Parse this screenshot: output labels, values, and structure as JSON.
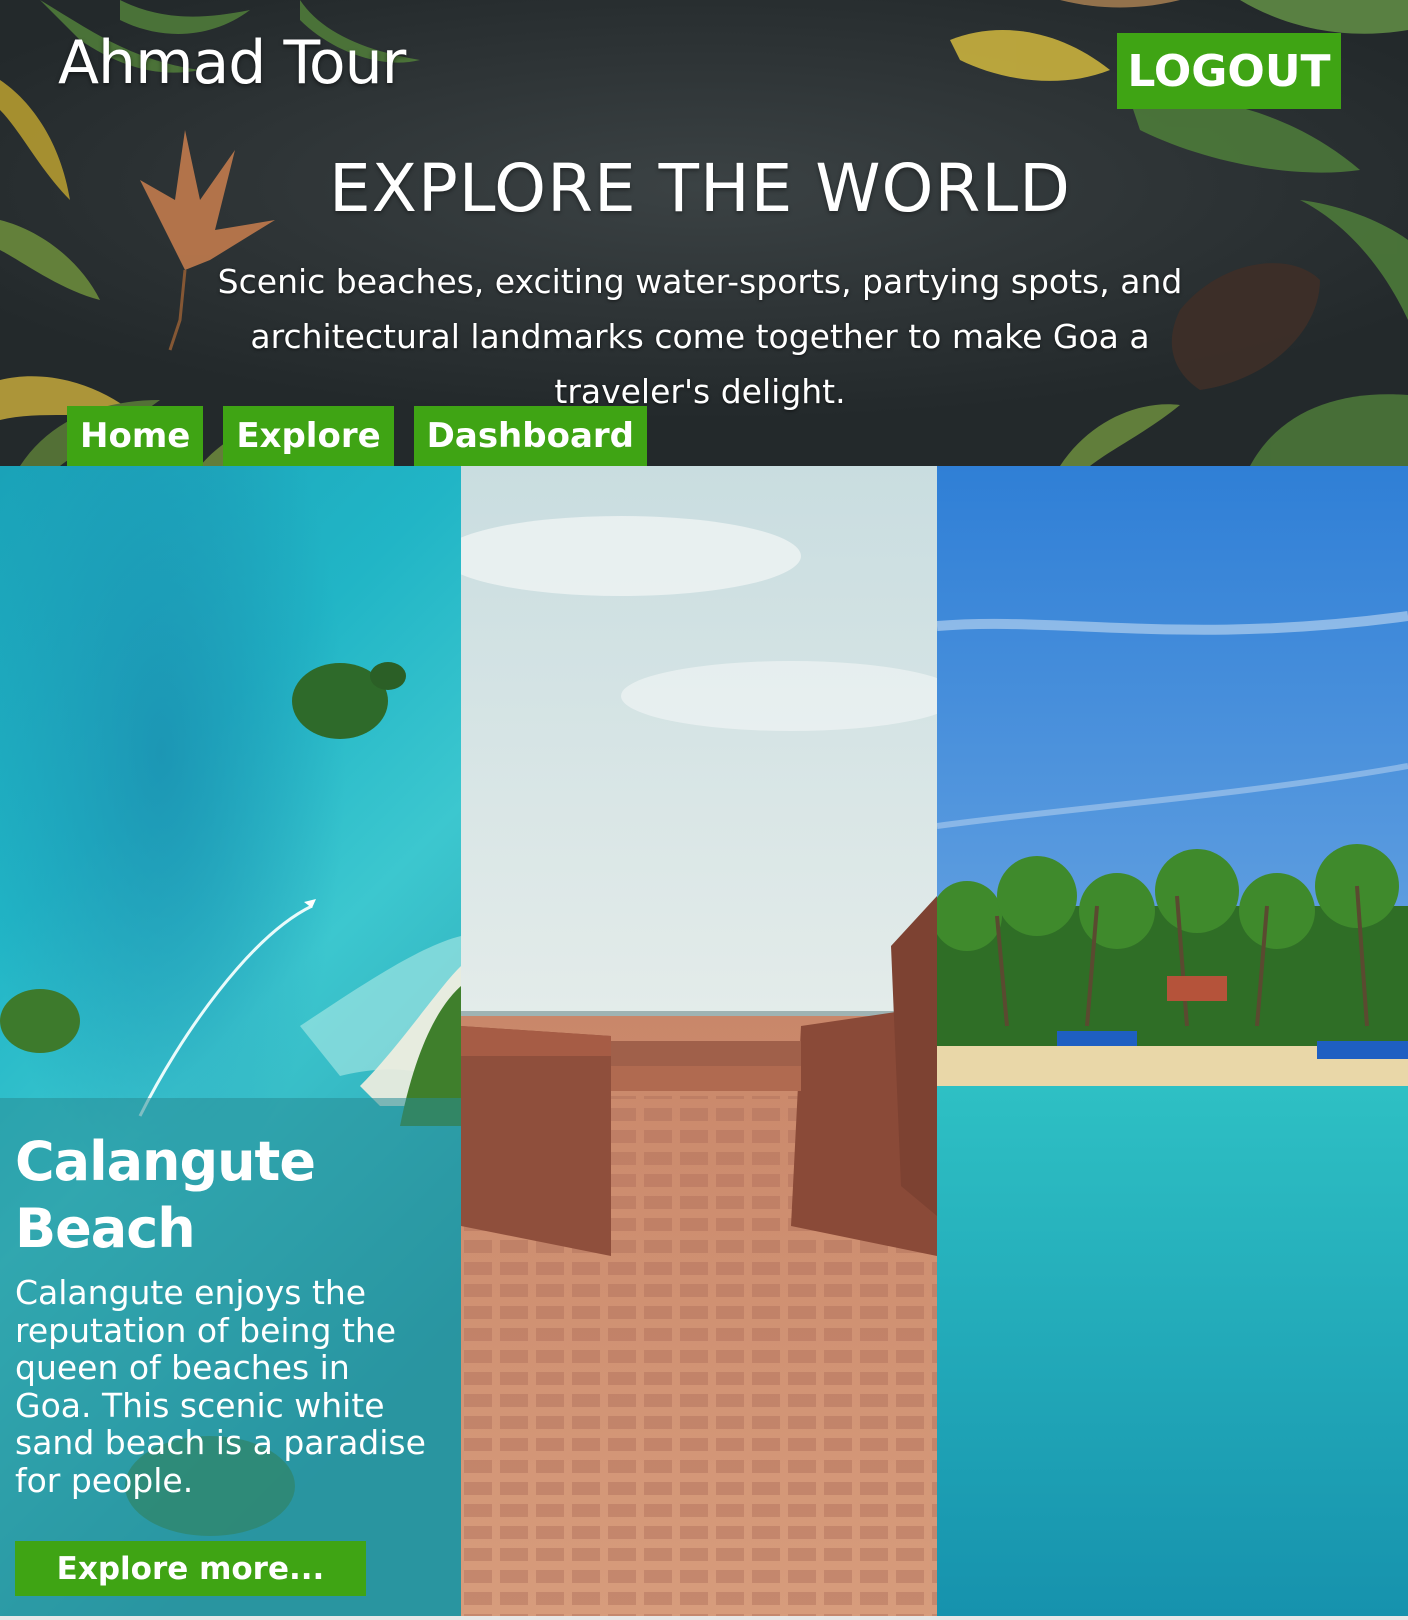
{
  "header": {
    "brand": "Ahmad Tour",
    "logout_label": "LOGOUT",
    "title": "EXPLORE THE WORLD",
    "description": "Scenic beaches, exciting water-sports, partying spots, and architectural landmarks come together to make Goa a traveler's delight."
  },
  "nav": {
    "items": [
      {
        "label": "Home"
      },
      {
        "label": "Explore"
      },
      {
        "label": "Dashboard"
      }
    ]
  },
  "cards": [
    {
      "title": "Calangute Beach",
      "text": "Calangute enjoys the reputation of being the queen of beaches in Goa. This scenic white sand beach is a paradise for people.",
      "button_label": "Explore more..."
    }
  ],
  "colors": {
    "accent": "#3fa414",
    "header_bg": "#2e3436",
    "card_overlay": "#288c96"
  }
}
